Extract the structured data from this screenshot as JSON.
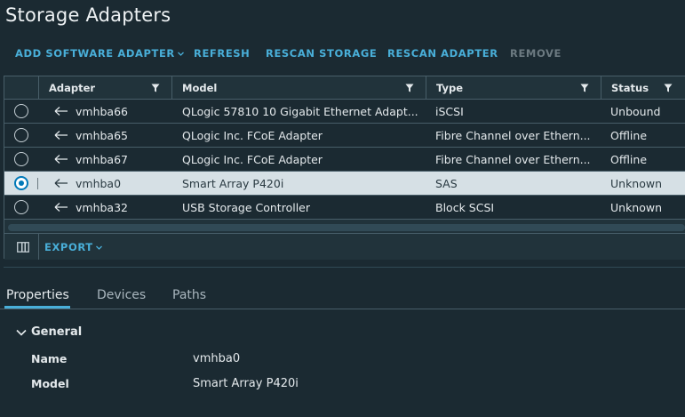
{
  "page": {
    "title": "Storage Adapters"
  },
  "toolbar": {
    "add_software_adapter": "ADD SOFTWARE ADAPTER",
    "refresh": "REFRESH",
    "rescan_storage": "RESCAN STORAGE",
    "rescan_adapter": "RESCAN ADAPTER",
    "remove": "REMOVE"
  },
  "table": {
    "columns": [
      "Adapter",
      "Model",
      "Type",
      "Status"
    ],
    "rows": [
      {
        "adapter": "vmhba66",
        "model": "QLogic 57810 10 Gigabit Ethernet Adapt...",
        "type": "iSCSI",
        "status": "Unbound",
        "selected": false
      },
      {
        "adapter": "vmhba65",
        "model": "QLogic Inc. FCoE Adapter",
        "type": "Fibre Channel over Ethern...",
        "status": "Offline",
        "selected": false
      },
      {
        "adapter": "vmhba67",
        "model": "QLogic Inc. FCoE Adapter",
        "type": "Fibre Channel over Ethern...",
        "status": "Offline",
        "selected": false
      },
      {
        "adapter": "vmhba0",
        "model": "Smart Array P420i",
        "type": "SAS",
        "status": "Unknown",
        "selected": true
      },
      {
        "adapter": "vmhba32",
        "model": "USB Storage Controller",
        "type": "Block SCSI",
        "status": "Unknown",
        "selected": false
      }
    ],
    "export_label": "EXPORT"
  },
  "tabs": [
    {
      "label": "Properties",
      "active": true
    },
    {
      "label": "Devices",
      "active": false
    },
    {
      "label": "Paths",
      "active": false
    }
  ],
  "details": {
    "section_title": "General",
    "properties": [
      {
        "label": "Name",
        "value": "vmhba0"
      },
      {
        "label": "Model",
        "value": "Smart Array P420i"
      }
    ]
  },
  "colors": {
    "background": "#1b2a32",
    "accent": "#49afd9",
    "selected_row": "#d6e0e5",
    "disabled": "#6c7a81"
  },
  "icons": [
    "chevron-down-icon",
    "filter-icon",
    "adapter-icon",
    "column-toggle-icon"
  ]
}
